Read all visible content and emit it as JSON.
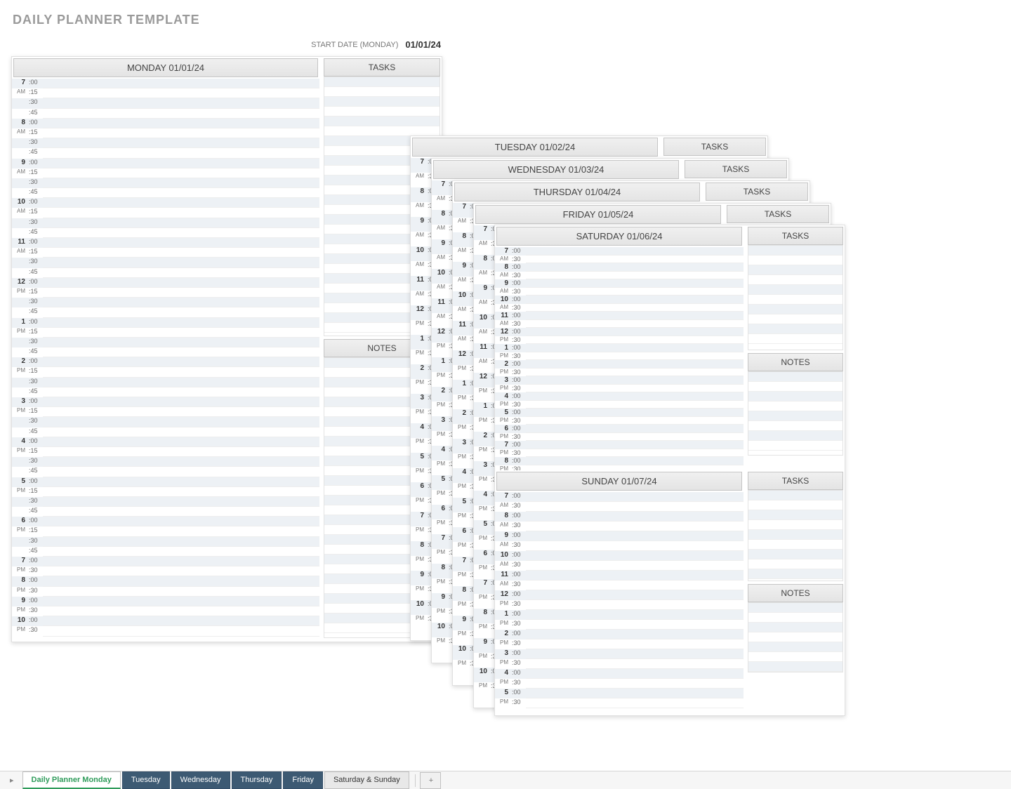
{
  "title": "DAILY PLANNER TEMPLATE",
  "start_label": "START DATE (MONDAY)",
  "start_date": "01/01/24",
  "labels": {
    "tasks": "TASKS",
    "notes": "NOTES"
  },
  "days": [
    {
      "name": "MONDAY 01/01/24"
    },
    {
      "name": "TUESDAY 01/02/24"
    },
    {
      "name": "WEDNESDAY 01/03/24"
    },
    {
      "name": "THURSDAY 01/04/24"
    },
    {
      "name": "FRIDAY 01/05/24"
    },
    {
      "name": "SATURDAY 01/06/24"
    },
    {
      "name": "SUNDAY 01/07/24"
    }
  ],
  "main_slots_15": {
    "hours": [
      {
        "h": "7",
        "ap": "AM"
      },
      {
        "h": "8",
        "ap": "AM"
      },
      {
        "h": "9",
        "ap": "AM"
      },
      {
        "h": "10",
        "ap": "AM"
      },
      {
        "h": "11",
        "ap": "AM"
      },
      {
        "h": "12",
        "ap": "PM"
      },
      {
        "h": "1",
        "ap": "PM"
      },
      {
        "h": "2",
        "ap": "PM"
      },
      {
        "h": "3",
        "ap": "PM"
      },
      {
        "h": "4",
        "ap": "PM"
      },
      {
        "h": "5",
        "ap": "PM"
      },
      {
        "h": "6",
        "ap": "PM"
      }
    ],
    "mins": [
      ":00",
      ":15",
      ":30",
      ":45"
    ],
    "tail30": [
      {
        "h": "7",
        "ap": "PM"
      },
      {
        "h": "8",
        "ap": "PM"
      },
      {
        "h": "9",
        "ap": "PM"
      },
      {
        "h": "10",
        "ap": "PM"
      }
    ],
    "tailmins": [
      ":00",
      ":30"
    ]
  },
  "bg_slots_30": {
    "hours": [
      {
        "h": "7",
        "ap": "AM"
      },
      {
        "h": "8",
        "ap": "AM"
      },
      {
        "h": "9",
        "ap": "AM"
      },
      {
        "h": "10",
        "ap": "AM"
      },
      {
        "h": "11",
        "ap": "AM"
      },
      {
        "h": "12",
        "ap": "PM"
      },
      {
        "h": "1",
        "ap": "PM"
      },
      {
        "h": "2",
        "ap": "PM"
      },
      {
        "h": "3",
        "ap": "PM"
      },
      {
        "h": "4",
        "ap": "PM"
      },
      {
        "h": "5",
        "ap": "PM"
      },
      {
        "h": "6",
        "ap": "PM"
      },
      {
        "h": "7",
        "ap": "PM"
      },
      {
        "h": "8",
        "ap": "PM"
      },
      {
        "h": "9",
        "ap": "PM"
      },
      {
        "h": "10",
        "ap": "PM"
      }
    ],
    "mins": [
      ":00",
      ":30"
    ]
  },
  "weekend_slots": {
    "hours": [
      {
        "h": "7",
        "ap": "AM"
      },
      {
        "h": "8",
        "ap": "AM"
      },
      {
        "h": "9",
        "ap": "AM"
      },
      {
        "h": "10",
        "ap": "AM"
      },
      {
        "h": "11",
        "ap": "AM"
      },
      {
        "h": "12",
        "ap": "PM"
      },
      {
        "h": "1",
        "ap": "PM"
      },
      {
        "h": "2",
        "ap": "PM"
      },
      {
        "h": "3",
        "ap": "PM"
      },
      {
        "h": "4",
        "ap": "PM"
      },
      {
        "h": "5",
        "ap": "PM"
      },
      {
        "h": "6",
        "ap": "PM"
      },
      {
        "h": "7",
        "ap": "PM"
      },
      {
        "h": "8",
        "ap": "PM"
      }
    ],
    "mins": [
      ":00",
      ":30"
    ]
  },
  "sunday_slots": {
    "hours": [
      {
        "h": "7",
        "ap": "AM"
      },
      {
        "h": "8",
        "ap": "AM"
      },
      {
        "h": "9",
        "ap": "AM"
      },
      {
        "h": "10",
        "ap": "AM"
      },
      {
        "h": "11",
        "ap": "AM"
      },
      {
        "h": "12",
        "ap": "PM"
      },
      {
        "h": "1",
        "ap": "PM"
      },
      {
        "h": "2",
        "ap": "PM"
      },
      {
        "h": "3",
        "ap": "PM"
      },
      {
        "h": "4",
        "ap": "PM"
      },
      {
        "h": "5",
        "ap": "PM"
      }
    ],
    "mins": [
      ":00",
      ":30"
    ]
  },
  "tabs": [
    {
      "label": "Daily Planner Monday",
      "kind": "active"
    },
    {
      "label": "Tuesday",
      "kind": "dark"
    },
    {
      "label": "Wednesday",
      "kind": "dark"
    },
    {
      "label": "Thursday",
      "kind": "dark"
    },
    {
      "label": "Friday",
      "kind": "dark"
    },
    {
      "label": "Saturday & Sunday",
      "kind": "plain"
    }
  ],
  "add_tab": "+"
}
